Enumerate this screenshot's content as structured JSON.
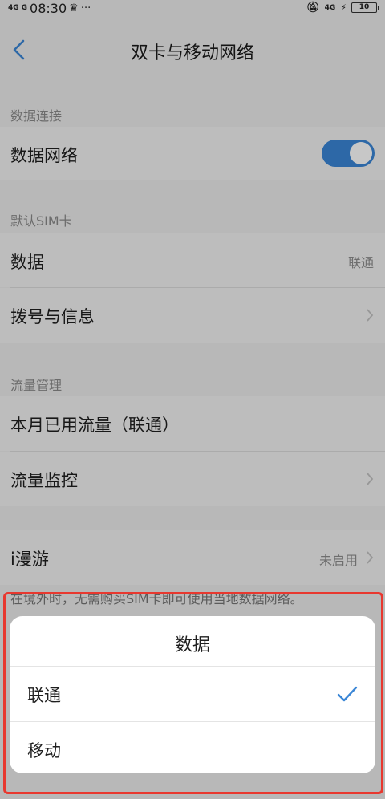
{
  "status_bar": {
    "signal_1": "4G",
    "signal_2": "G",
    "time": "08:30",
    "more": "···",
    "signal_right": "4G",
    "battery": "10"
  },
  "header": {
    "title": "双卡与移动网络"
  },
  "sections": {
    "data_connection": {
      "label": "数据连接",
      "data_network": "数据网络",
      "data_network_on": true
    },
    "default_sim": {
      "label": "默认SIM卡",
      "data": "数据",
      "data_value": "联通",
      "dial": "拨号与信息"
    },
    "traffic": {
      "label": "流量管理",
      "used": "本月已用流量（联通）",
      "monitor": "流量监控"
    },
    "roaming": {
      "label": "i漫游",
      "value": "未启用",
      "note": "在境外时，无需购买SIM卡即可使用当地数据网络。"
    }
  },
  "dialog": {
    "title": "数据",
    "options": [
      {
        "label": "联通",
        "selected": true
      },
      {
        "label": "移动",
        "selected": false
      }
    ]
  },
  "colors": {
    "accent": "#3a86d6",
    "highlight": "#e8382f"
  }
}
